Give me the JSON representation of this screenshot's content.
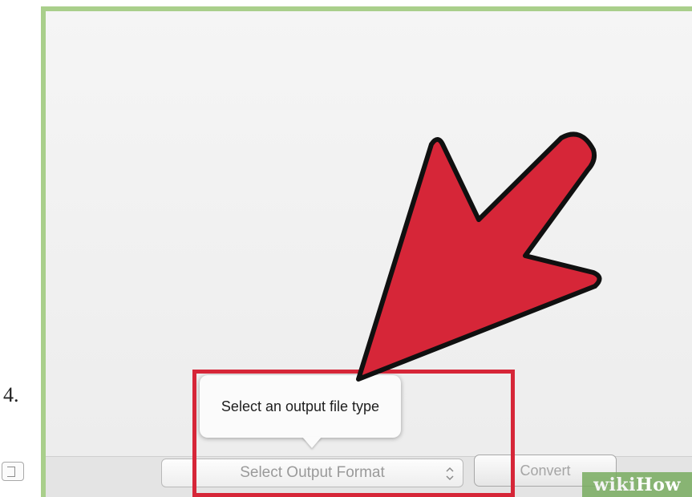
{
  "step": {
    "number": "4."
  },
  "tooltip": {
    "text": "Select an output file type"
  },
  "format_select": {
    "placeholder": "Select Output Format"
  },
  "convert_button": {
    "label": "Convert"
  },
  "watermark": {
    "part1": "wiki",
    "part2": "How"
  },
  "colors": {
    "frame_border": "#a9cf8b",
    "highlight": "#d62638",
    "arrow_fill": "#d62638",
    "watermark_bg": "#78ac5f"
  },
  "icons": {
    "arrow": "big-pointer-arrow-icon",
    "select": "select-updown-icon",
    "checkbox": "checkbox-icon"
  }
}
